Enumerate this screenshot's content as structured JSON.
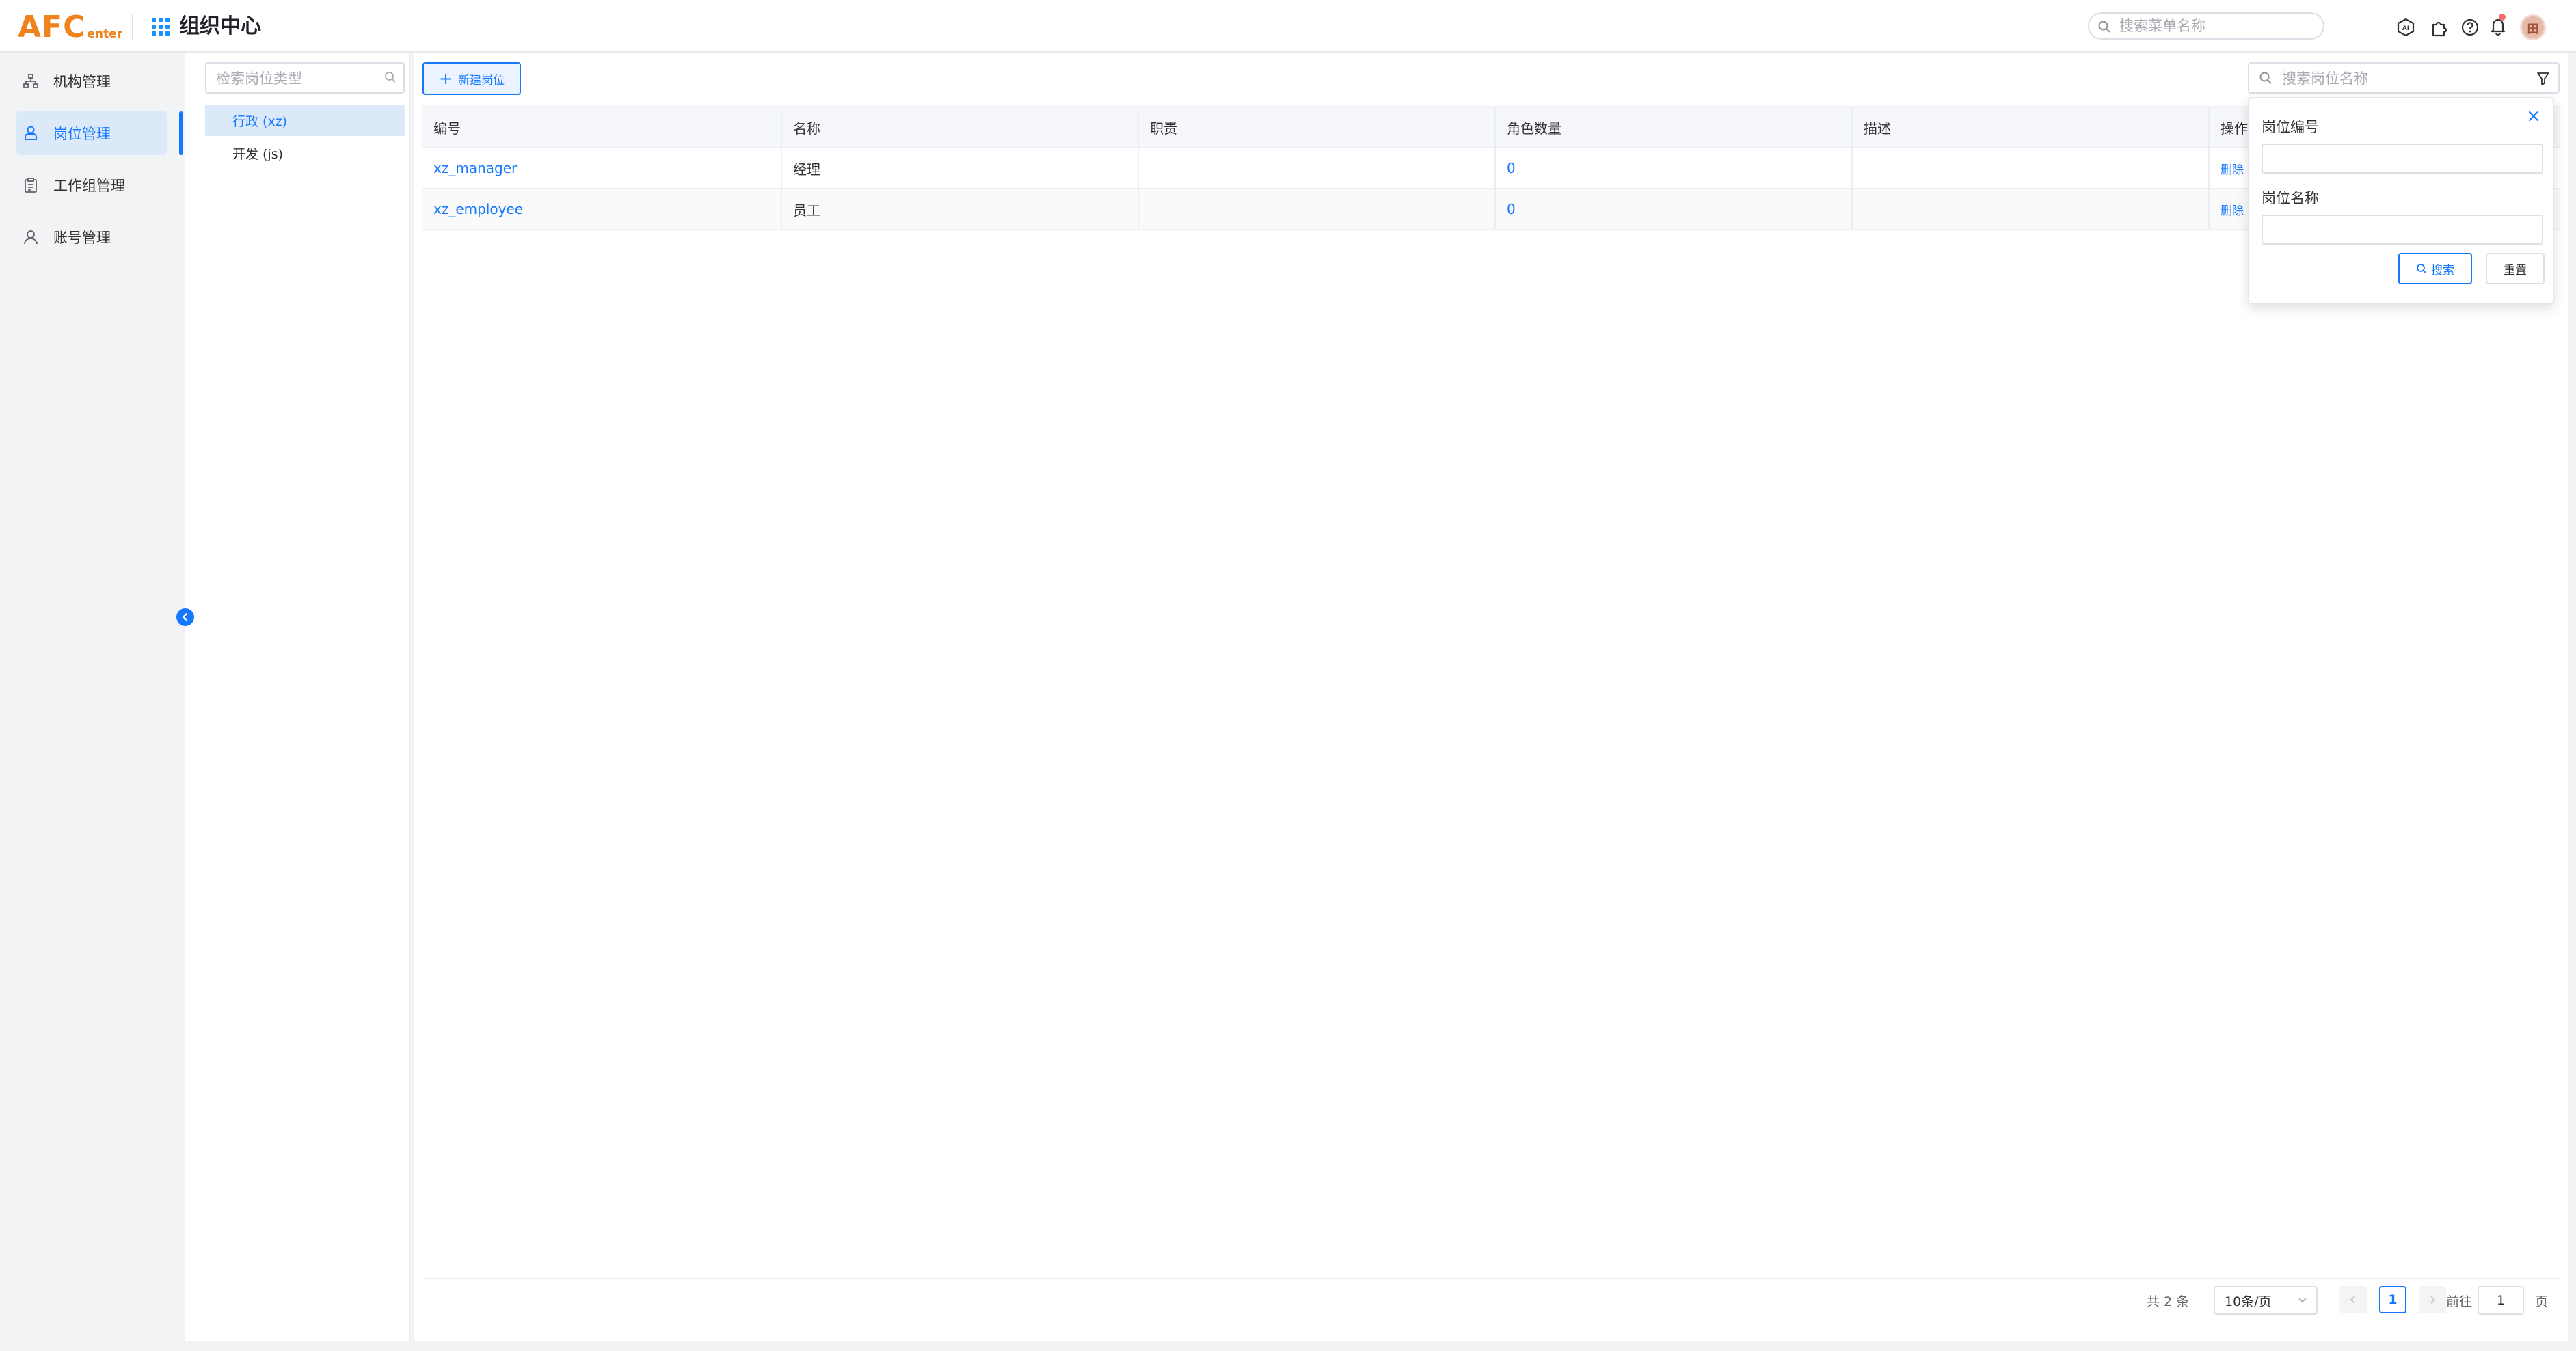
{
  "header": {
    "logo_big": "AFC",
    "logo_small": "enter",
    "app_title": "组织中心",
    "menu_search_placeholder": "搜索菜单名称",
    "avatar_text": "田"
  },
  "sidebar": {
    "items": [
      {
        "label": "机构管理",
        "icon": "org-tree-icon",
        "active": false
      },
      {
        "label": "岗位管理",
        "icon": "user-badge-icon",
        "active": true
      },
      {
        "label": "工作组管理",
        "icon": "clipboard-icon",
        "active": false
      },
      {
        "label": "账号管理",
        "icon": "user-icon",
        "active": false
      }
    ]
  },
  "categories": {
    "search_placeholder": "检索岗位类型",
    "items": [
      {
        "label": "行政 (xz)",
        "active": true
      },
      {
        "label": "开发 (js)",
        "active": false
      }
    ]
  },
  "toolbar": {
    "new_button": "新建岗位",
    "search_placeholder": "搜索岗位名称"
  },
  "table": {
    "columns": [
      "编号",
      "名称",
      "职责",
      "角色数量",
      "描述",
      "操作"
    ],
    "rows": [
      {
        "code": "xz_manager",
        "name": "经理",
        "duty": "",
        "role_count": "0",
        "desc": "",
        "action": "删除"
      },
      {
        "code": "xz_employee",
        "name": "员工",
        "duty": "",
        "role_count": "0",
        "desc": "",
        "action": "删除"
      }
    ]
  },
  "pagination": {
    "total": "共 2 条",
    "page_size": "10条/页",
    "current": "1",
    "goto_label": "前往",
    "goto_value": "1",
    "page_unit": "页"
  },
  "filter_popover": {
    "field1_label": "岗位编号",
    "field2_label": "岗位名称",
    "search_button": "搜索",
    "reset_button": "重置"
  },
  "colors": {
    "accent": "#1677ff",
    "brand": "#f0821e",
    "active_bg": "#dbe9f8"
  }
}
